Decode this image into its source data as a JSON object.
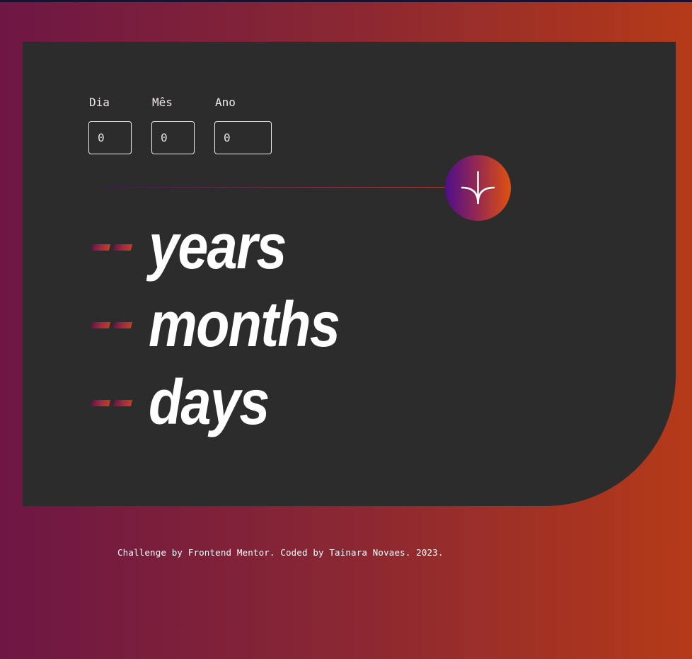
{
  "form": {
    "day": {
      "label": "Dia",
      "value": "0"
    },
    "month": {
      "label": "Mês",
      "value": "0"
    },
    "year": {
      "label": "Ano",
      "value": "0"
    },
    "submit_icon": "arrow-down-icon"
  },
  "results": {
    "years": {
      "value": "- -",
      "unit": "years"
    },
    "months": {
      "value": "- -",
      "unit": "months"
    },
    "days": {
      "value": "- -",
      "unit": "days"
    }
  },
  "footer": {
    "text": "Challenge by Frontend Mentor. Coded by Tainara Novaes. 2023."
  },
  "colors": {
    "card": "#2c2c2c",
    "gradient_start": "#6e1744",
    "gradient_end": "#b53a18",
    "button_start": "#4e0e8a",
    "button_end": "#e0500e"
  }
}
